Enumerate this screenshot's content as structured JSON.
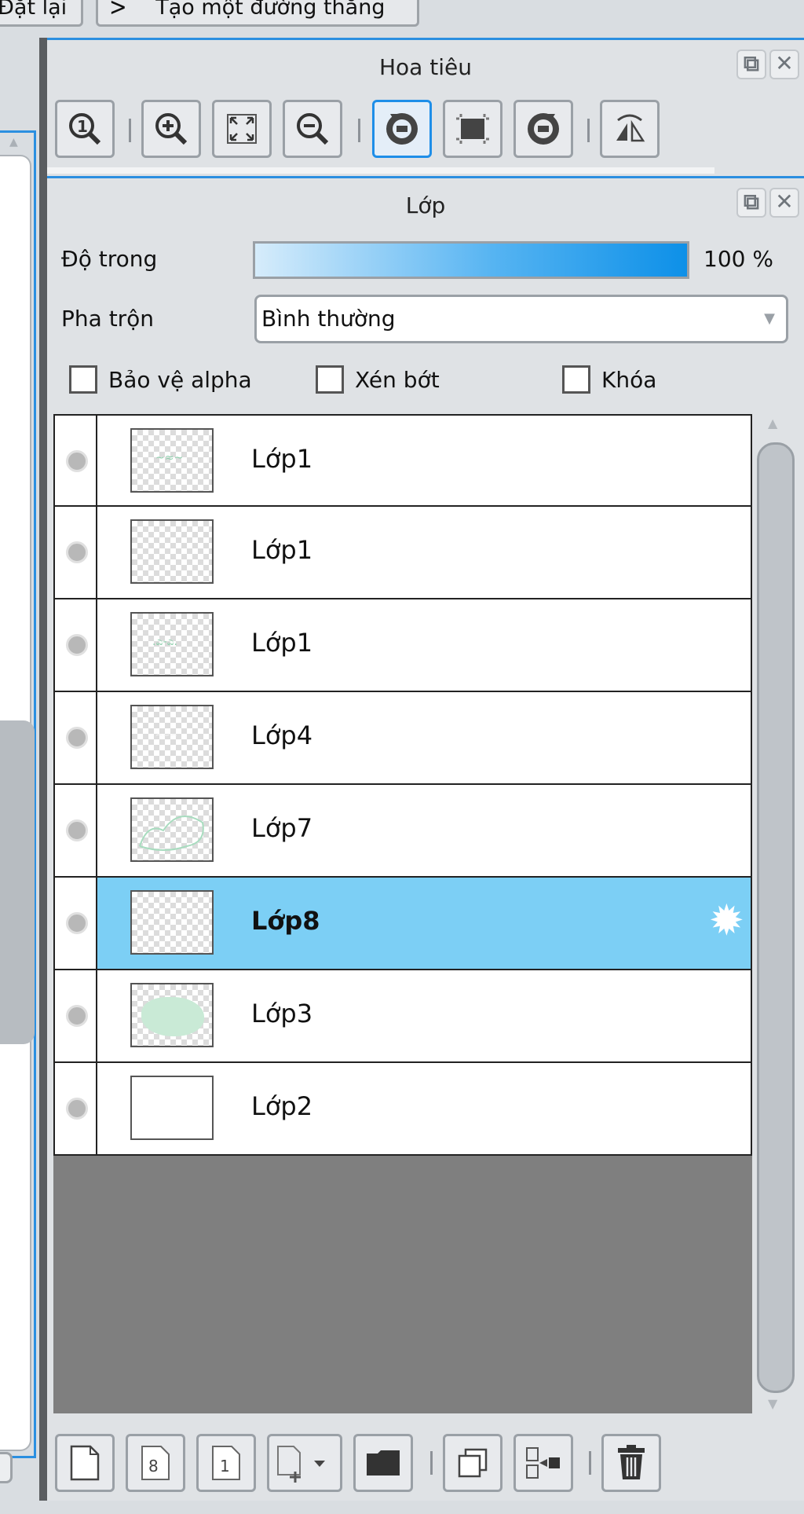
{
  "top_bar": {
    "reset_label": "Đặt lại",
    "create_line_label": "Tạo một đường thẳng"
  },
  "navigator": {
    "title": "Hoa tiêu",
    "tools": [
      {
        "icon": "zoom-actual-size-icon"
      },
      {
        "icon": "zoom-in-icon"
      },
      {
        "icon": "fit-to-window-icon"
      },
      {
        "icon": "zoom-out-icon"
      },
      {
        "icon": "rotate-left-icon",
        "active": true
      },
      {
        "icon": "reset-rotation-icon"
      },
      {
        "icon": "rotate-right-icon"
      },
      {
        "icon": "flip-horizontal-icon"
      }
    ]
  },
  "layers": {
    "title": "Lớp",
    "opacity_label": "Độ trong",
    "opacity_value": "100 %",
    "opacity_percent": 100,
    "blend_label": "Pha trộn",
    "blend_value": "Bình thường",
    "protect_alpha_label": "Bảo vệ alpha",
    "clipping_label": "Xén bớt",
    "lock_label": "Khóa",
    "items": [
      {
        "name": "Lớp1",
        "selected": false
      },
      {
        "name": "Lớp1",
        "selected": false
      },
      {
        "name": "Lớp1",
        "selected": false
      },
      {
        "name": "Lớp4",
        "selected": false
      },
      {
        "name": "Lớp7",
        "selected": false
      },
      {
        "name": "Lớp8",
        "selected": true
      },
      {
        "name": "Lớp3",
        "selected": false
      },
      {
        "name": "Lớp2",
        "selected": false
      }
    ],
    "bottom_tools": [
      {
        "icon": "new-layer-icon"
      },
      {
        "icon": "new-8bit-layer-icon",
        "glyph": "8"
      },
      {
        "icon": "new-1bit-layer-icon",
        "glyph": "1"
      },
      {
        "icon": "add-layer-dropdown-icon"
      },
      {
        "icon": "new-folder-icon"
      },
      {
        "icon": "duplicate-layer-icon"
      },
      {
        "icon": "merge-down-icon"
      },
      {
        "icon": "delete-layer-icon"
      }
    ]
  },
  "window_controls": {
    "popout_glyph": "⧉",
    "close_glyph": "✕"
  }
}
